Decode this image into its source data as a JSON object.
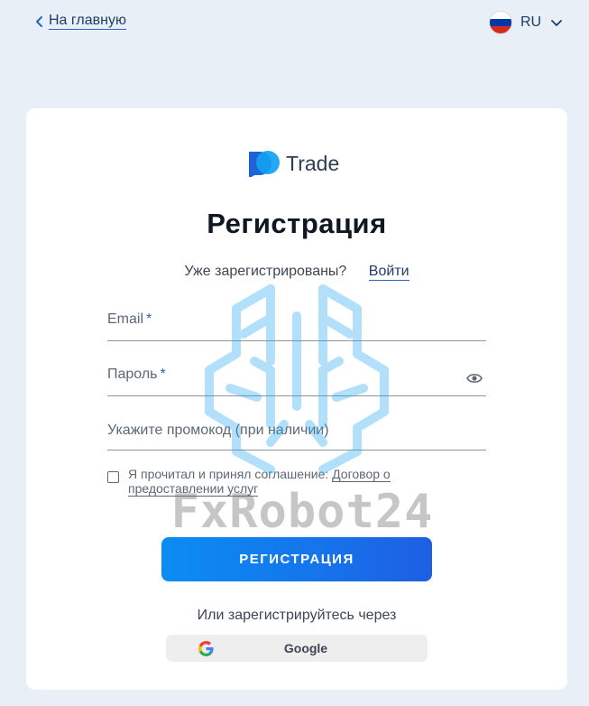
{
  "header": {
    "back_label": "На главную",
    "lang_code": "RU",
    "flag_colors": [
      "#ffffff",
      "#0039a6",
      "#d52b1e"
    ]
  },
  "card": {
    "logo_text": "Trade",
    "title": "Регистрация",
    "have_account_text": "Уже зарегистрированы?",
    "login_link": "Войти",
    "email_label": "Email",
    "password_label": "Пароль",
    "required_mark": "*",
    "promo_label": "Укажите промокод (при наличии)",
    "agree_text": "Я прочитал и принял соглашение:",
    "agree_link": "Договор о предоставлении услуг",
    "register_button": "РЕГИСТРАЦИЯ",
    "or_text": "Или зарегистрируйтесь через",
    "google_label": "Google"
  },
  "watermark_text": "FxRobot24",
  "colors": {
    "accent": "#1575ec",
    "background": "#e9eff6",
    "card": "#ffffff"
  },
  "icons": [
    "chevron-left-icon",
    "chevron-down-icon",
    "eye-icon",
    "google-icon",
    "checkbox-icon"
  ]
}
